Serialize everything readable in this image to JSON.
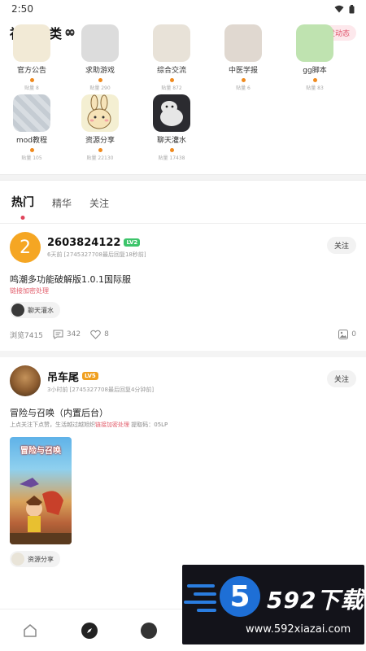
{
  "status": {
    "time": "2:50"
  },
  "community": {
    "title": "社区分类",
    "dynamic_btn": "+ 发动态",
    "categories": [
      {
        "name": "官方公告",
        "count": "贴量 8"
      },
      {
        "name": "求助游戏",
        "count": "贴量 290"
      },
      {
        "name": "综合交流",
        "count": "贴量 872"
      },
      {
        "name": "中医学报",
        "count": "贴量 6"
      },
      {
        "name": "gg脚本",
        "count": "贴量 83"
      },
      {
        "name": "mod教程",
        "count": "贴量 105"
      },
      {
        "name": "资源分享",
        "count": "贴量 22130"
      },
      {
        "name": "聊天灌水",
        "count": "贴量 17438"
      }
    ]
  },
  "tabs": [
    {
      "label": "热门"
    },
    {
      "label": "精华"
    },
    {
      "label": "关注"
    }
  ],
  "posts": [
    {
      "avatar_text": "2",
      "username": "2603824122",
      "level": "LV2",
      "meta": "6天前 [2745327708最后回复18秒前]",
      "follow": "关注",
      "title": "鸣潮多功能破解版1.0.1国际服",
      "link": "链接加密处理",
      "tag": "聊天灌水",
      "views": "浏览7415",
      "comments": "342",
      "likes": "8",
      "images": "0"
    },
    {
      "username": "吊车尾",
      "level": "LV5",
      "meta": "3小时前 [2745327708最后回复4分钟前]",
      "follow": "关注",
      "title": "冒险与召唤（内置后台）",
      "sub_prefix": "上点关注下点赞，生活越过越旭炽",
      "sub_link": "链接加密处理",
      "sub_suffix": "提取码：05LP",
      "image_title": "冒险与召唤",
      "tag": "资源分享"
    }
  ],
  "watermark": {
    "number": "5",
    "brand": "592下载",
    "url": "www.592xiazai.com"
  }
}
